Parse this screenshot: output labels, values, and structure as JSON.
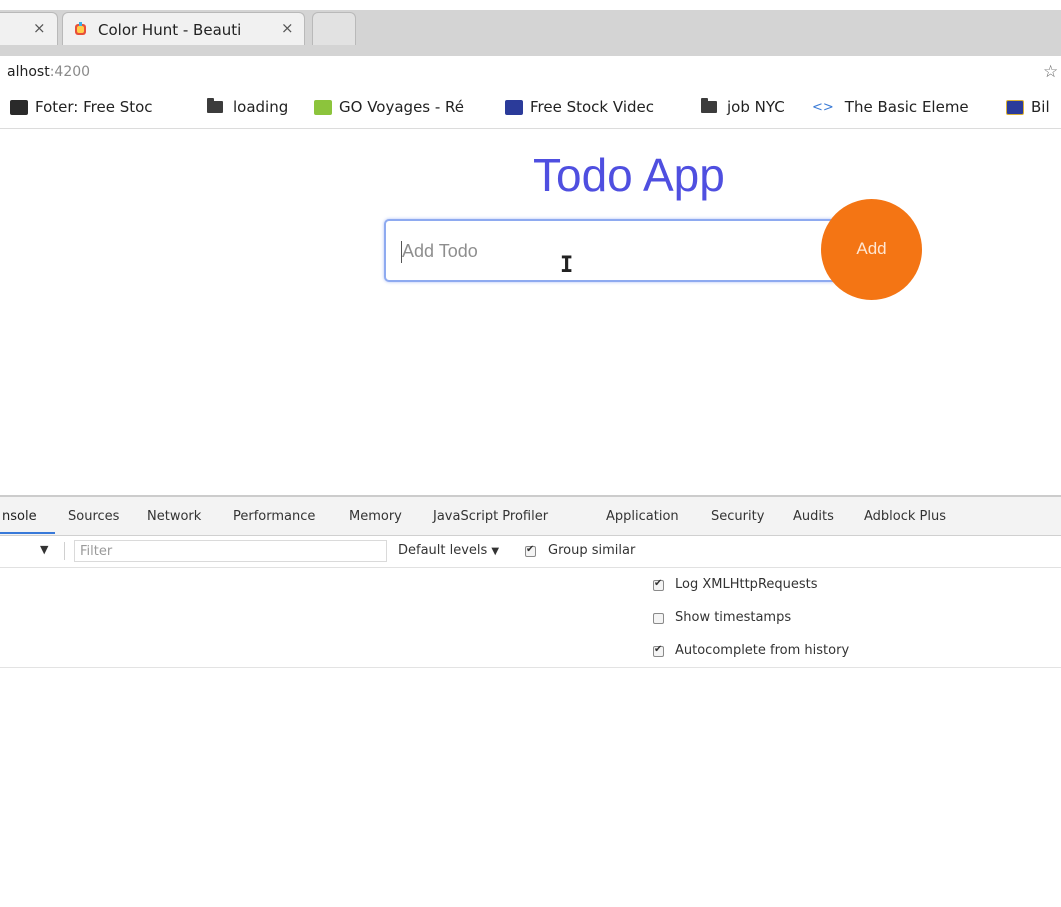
{
  "browser": {
    "tabs": [
      {
        "title": "",
        "close_glyph": "×"
      },
      {
        "title": "Color Hunt - Beauti",
        "close_glyph": "×",
        "favicon": "colorhunt-icon"
      },
      {
        "title": "",
        "new_tab": true
      }
    ],
    "address": {
      "host": "alhost",
      "port": ":4200",
      "star_glyph": "☆"
    },
    "bookmarks": [
      {
        "label": "Foter: Free Stoc",
        "icon": "foter-icon"
      },
      {
        "label": "loading",
        "icon": "folder-icon"
      },
      {
        "label": "GO Voyages - Ré",
        "icon": "govoyages-icon"
      },
      {
        "label": "Free Stock Videc",
        "icon": "videvo-icon"
      },
      {
        "label": "job NYC",
        "icon": "folder-icon"
      },
      {
        "label": "The Basic Eleme",
        "icon": "link-icon"
      },
      {
        "label": "Bil",
        "icon": "bookmark-icon"
      }
    ]
  },
  "app": {
    "title": "Todo App",
    "input": {
      "placeholder": "Add Todo",
      "value": ""
    },
    "add_button_label": "Add",
    "colors": {
      "title": "#4f4fe0",
      "add_button": "#f47514",
      "input_border": "#8eaaf0"
    }
  },
  "devtools": {
    "tabs": [
      "nsole",
      "Sources",
      "Network",
      "Performance",
      "Memory",
      "JavaScript Profiler",
      "Application",
      "Security",
      "Audits",
      "Adblock Plus"
    ],
    "active_tab": "nsole",
    "toolbar": {
      "context_arrow": "▼",
      "filter_placeholder": "Filter",
      "levels_label": "Default levels",
      "levels_arrow": "▼",
      "group_similar": {
        "label": "Group similar",
        "checked": true
      }
    },
    "settings": [
      {
        "label": "Log XMLHttpRequests",
        "checked": true
      },
      {
        "label": "Show timestamps",
        "checked": false
      },
      {
        "label": "Autocomplete from history",
        "checked": true
      }
    ]
  }
}
